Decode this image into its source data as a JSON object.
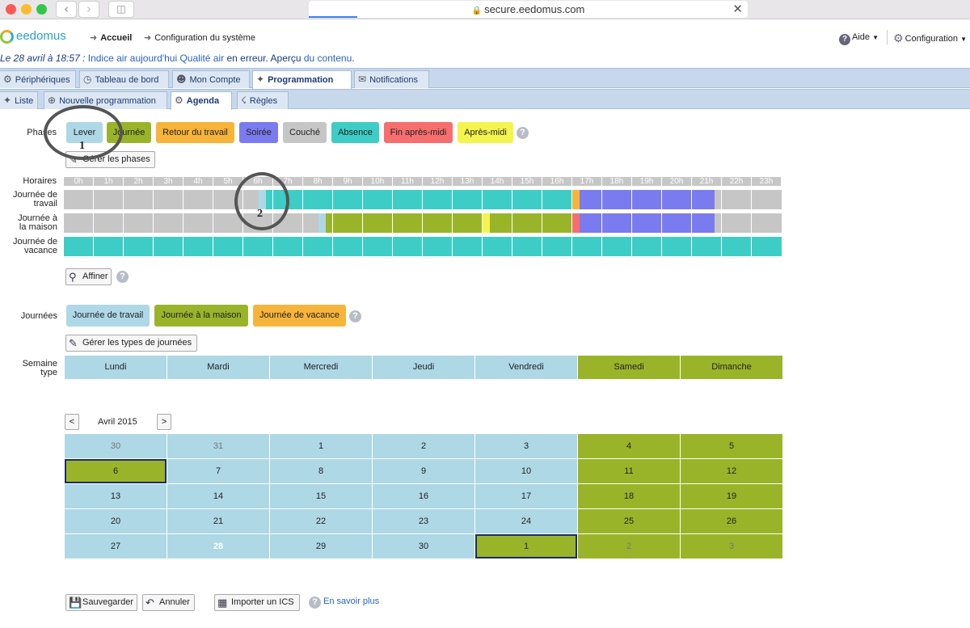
{
  "browser": {
    "url": "secure.eedomus.com",
    "lock_icon": "lock-icon",
    "close_icon": "close-icon"
  },
  "header": {
    "logo": "eedomus",
    "breadcrumb": [
      "Accueil",
      "Configuration du système"
    ],
    "help_label": "Aide",
    "config_label": "Configuration"
  },
  "notice": {
    "prefix": "Le 28 avril à 18:57 : ",
    "device": "Indice air aujourd'hui Qualité air",
    "middle": " en erreur. Aperçu ",
    "link": "du contenu",
    "suffix": "."
  },
  "main_tabs": [
    {
      "label": "Périphériques",
      "icon": "gear-icon"
    },
    {
      "label": "Tableau de bord",
      "icon": "dashboard-icon"
    },
    {
      "label": "Mon Compte",
      "icon": "user-icon"
    },
    {
      "label": "Programmation",
      "icon": "wand-icon",
      "active": true
    },
    {
      "label": "Notifications",
      "icon": "mail-icon"
    }
  ],
  "sub_tabs": [
    {
      "label": "Liste",
      "icon": "wand-icon"
    },
    {
      "label": "Nouvelle programmation",
      "icon": "plus-icon"
    },
    {
      "label": "Agenda",
      "icon": "gear-icon",
      "active": true
    },
    {
      "label": "Règles",
      "icon": "rules-icon"
    }
  ],
  "phases": {
    "label": "Phases",
    "items": [
      {
        "label": "Lever",
        "color": "#aed8e6"
      },
      {
        "label": "Journée",
        "color": "#9ab42a"
      },
      {
        "label": "Retour du travail",
        "color": "#f7b43a"
      },
      {
        "label": "Soirée",
        "color": "#7b7bf0"
      },
      {
        "label": "Couché",
        "color": "#c6c6c6"
      },
      {
        "label": "Absence",
        "color": "#3ecdc6"
      },
      {
        "label": "Fin après-midi",
        "color": "#f76e6e"
      },
      {
        "label": "Après-midi",
        "color": "#f4f44e"
      }
    ],
    "manage_label": "Gérer les phases"
  },
  "schedule": {
    "label": "Horaires",
    "hours": [
      "0h",
      "1h",
      "2h",
      "3h",
      "4h",
      "5h",
      "6h",
      "7h",
      "8h",
      "9h",
      "10h",
      "11h",
      "12h",
      "13h",
      "14h",
      "15h",
      "16h",
      "17h",
      "18h",
      "19h",
      "20h",
      "21h",
      "22h",
      "23h"
    ],
    "rows": [
      {
        "label_lines": [
          "Journée de",
          "travail"
        ],
        "segments": [
          [
            "Couché",
            0,
            6.5
          ],
          [
            "Lever",
            6.5,
            6.75
          ],
          [
            "Absence",
            6.75,
            17
          ],
          [
            "Retour du travail",
            17,
            17.25
          ],
          [
            "Soirée",
            17.25,
            21.75
          ],
          [
            "Couché",
            21.75,
            24
          ]
        ]
      },
      {
        "label_lines": [
          "Journée à",
          "la maison"
        ],
        "segments": [
          [
            "Couché",
            0,
            8.5
          ],
          [
            "Lever",
            8.5,
            8.75
          ],
          [
            "Journée",
            8.75,
            14
          ],
          [
            "Après-midi",
            14,
            14.25
          ],
          [
            "Journée",
            14.25,
            17
          ],
          [
            "Fin après-midi",
            17,
            17.25
          ],
          [
            "Soirée",
            17.25,
            21.75
          ],
          [
            "Couché",
            21.75,
            24
          ]
        ]
      },
      {
        "label_lines": [
          "Journée de",
          "vacance"
        ],
        "segments": [
          [
            "Absence",
            0,
            24
          ]
        ]
      }
    ],
    "refine_label": "Affiner"
  },
  "day_types": {
    "label": "Journées",
    "items": [
      {
        "label": "Journée de travail",
        "color": "#aed8e6"
      },
      {
        "label": "Journée à la maison",
        "color": "#9ab42a"
      },
      {
        "label": "Journée de vacance",
        "color": "#f7b43a"
      }
    ],
    "manage_label": "Gérer les types de journées"
  },
  "week": {
    "label_lines": [
      "Semaine",
      "type"
    ],
    "days": [
      {
        "label": "Lundi",
        "type": "Journée de travail"
      },
      {
        "label": "Mardi",
        "type": "Journée de travail"
      },
      {
        "label": "Mercredi",
        "type": "Journée de travail"
      },
      {
        "label": "Jeudi",
        "type": "Journée de travail"
      },
      {
        "label": "Vendredi",
        "type": "Journée de travail"
      },
      {
        "label": "Samedi",
        "type": "Journée à la maison"
      },
      {
        "label": "Dimanche",
        "type": "Journée à la maison"
      }
    ]
  },
  "calendar": {
    "title": "Avril 2015",
    "prev_label": "<",
    "next_label": ">",
    "rows": [
      [
        {
          "d": "30",
          "t": "w",
          "o": true
        },
        {
          "d": "31",
          "t": "w",
          "o": true
        },
        {
          "d": "1",
          "t": "w"
        },
        {
          "d": "2",
          "t": "w"
        },
        {
          "d": "3",
          "t": "w"
        },
        {
          "d": "4",
          "t": "h"
        },
        {
          "d": "5",
          "t": "h"
        }
      ],
      [
        {
          "d": "6",
          "t": "h",
          "s": true
        },
        {
          "d": "7",
          "t": "w"
        },
        {
          "d": "8",
          "t": "w"
        },
        {
          "d": "9",
          "t": "w"
        },
        {
          "d": "10",
          "t": "w"
        },
        {
          "d": "11",
          "t": "h"
        },
        {
          "d": "12",
          "t": "h"
        }
      ],
      [
        {
          "d": "13",
          "t": "w"
        },
        {
          "d": "14",
          "t": "w"
        },
        {
          "d": "15",
          "t": "w"
        },
        {
          "d": "16",
          "t": "w"
        },
        {
          "d": "17",
          "t": "w"
        },
        {
          "d": "18",
          "t": "h"
        },
        {
          "d": "19",
          "t": "h"
        }
      ],
      [
        {
          "d": "20",
          "t": "w"
        },
        {
          "d": "21",
          "t": "w"
        },
        {
          "d": "22",
          "t": "w"
        },
        {
          "d": "23",
          "t": "w"
        },
        {
          "d": "24",
          "t": "w"
        },
        {
          "d": "25",
          "t": "h"
        },
        {
          "d": "26",
          "t": "h"
        }
      ],
      [
        {
          "d": "27",
          "t": "w"
        },
        {
          "d": "28",
          "t": "w",
          "today": true
        },
        {
          "d": "29",
          "t": "w"
        },
        {
          "d": "30",
          "t": "w"
        },
        {
          "d": "1",
          "t": "h",
          "s": true
        },
        {
          "d": "2",
          "t": "h",
          "o": true
        },
        {
          "d": "3",
          "t": "h",
          "o": true
        }
      ]
    ]
  },
  "actions": {
    "save": "Sauvegarder",
    "cancel": "Annuler",
    "import": "Importer un ICS",
    "learn_more": "En savoir plus"
  },
  "annotations": [
    "1",
    "2"
  ]
}
